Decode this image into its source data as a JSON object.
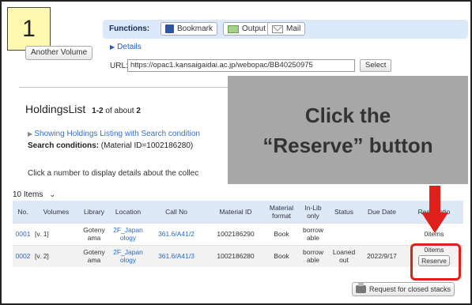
{
  "step_number": "1",
  "another_volume_label": "Another Volume",
  "functions": {
    "label": "Functions:",
    "bookmark": "Bookmark",
    "output": "Output",
    "mail": "Mail"
  },
  "details_label": "Details",
  "url": {
    "label": "URL:",
    "value": "https://opac1.kansaigaidai.ac.jp/webopac/BB40250975",
    "select_label": "Select"
  },
  "holdings": {
    "title": "HoldingsList",
    "range": "1-2",
    "of_about": "of about",
    "total": "2",
    "showing_link": "Showing Holdings Listing with Search condition",
    "conditions_label": "Search conditions:",
    "conditions_value": "(Material ID=1002186280)",
    "click_number_text": "Click a number to display details about the collec"
  },
  "callout": {
    "line1": "Click the",
    "line2": "“Reserve” button"
  },
  "items_per_page": "10 Items",
  "table": {
    "headers": [
      "No.",
      "Volumes",
      "Library",
      "Location",
      "Call No",
      "Material ID",
      "Material format",
      "In-Lib only",
      "Status",
      "Due Date",
      "Reservatio"
    ],
    "rows": [
      {
        "no": "0001",
        "volumes": "[v. 1]",
        "library": "Goteny ama",
        "location": "2F_Japan ology",
        "call_no": "361.6/A41/2",
        "material_id": "1002186290",
        "format": "Book",
        "in_lib": "borrow able",
        "status": "",
        "due_date": "",
        "reservation_count": "0items",
        "reserve_label": ""
      },
      {
        "no": "0002",
        "volumes": "[v. 2]",
        "library": "Goteny ama",
        "location": "2F_Japan ology",
        "call_no": "361.6/A41/3",
        "material_id": "1002186280",
        "format": "Book",
        "in_lib": "borrow able",
        "status": "Loaned out",
        "due_date": "2022/9/17",
        "reservation_count": "0items",
        "reserve_label": "Reserve"
      }
    ]
  },
  "closed_stacks_label": "Request for closed stacks",
  "colors": {
    "highlight_red": "#e0201a",
    "header_bg": "#dde9f6",
    "functions_bg": "#dbe9fb",
    "link_blue": "#2a6bc6"
  }
}
